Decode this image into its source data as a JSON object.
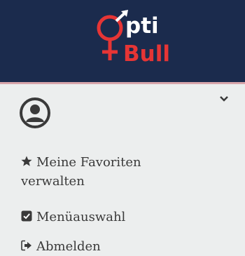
{
  "logo": {
    "text_top": "pti",
    "text_bottom": "Bull",
    "colors": {
      "white": "#ffffff",
      "red": "#e63535"
    }
  },
  "header": {
    "background": "#1b2b4d"
  },
  "user": {
    "avatar_icon": "user-circle-icon",
    "toggle_icon": "chevron-down-icon"
  },
  "menu": {
    "items": [
      {
        "icon": "star-icon",
        "label": "Meine Favoriten verwalten"
      },
      {
        "icon": "checkbox-checked-icon",
        "label": "Menüauswahl"
      },
      {
        "icon": "sign-out-icon",
        "label": "Abmelden"
      }
    ]
  }
}
